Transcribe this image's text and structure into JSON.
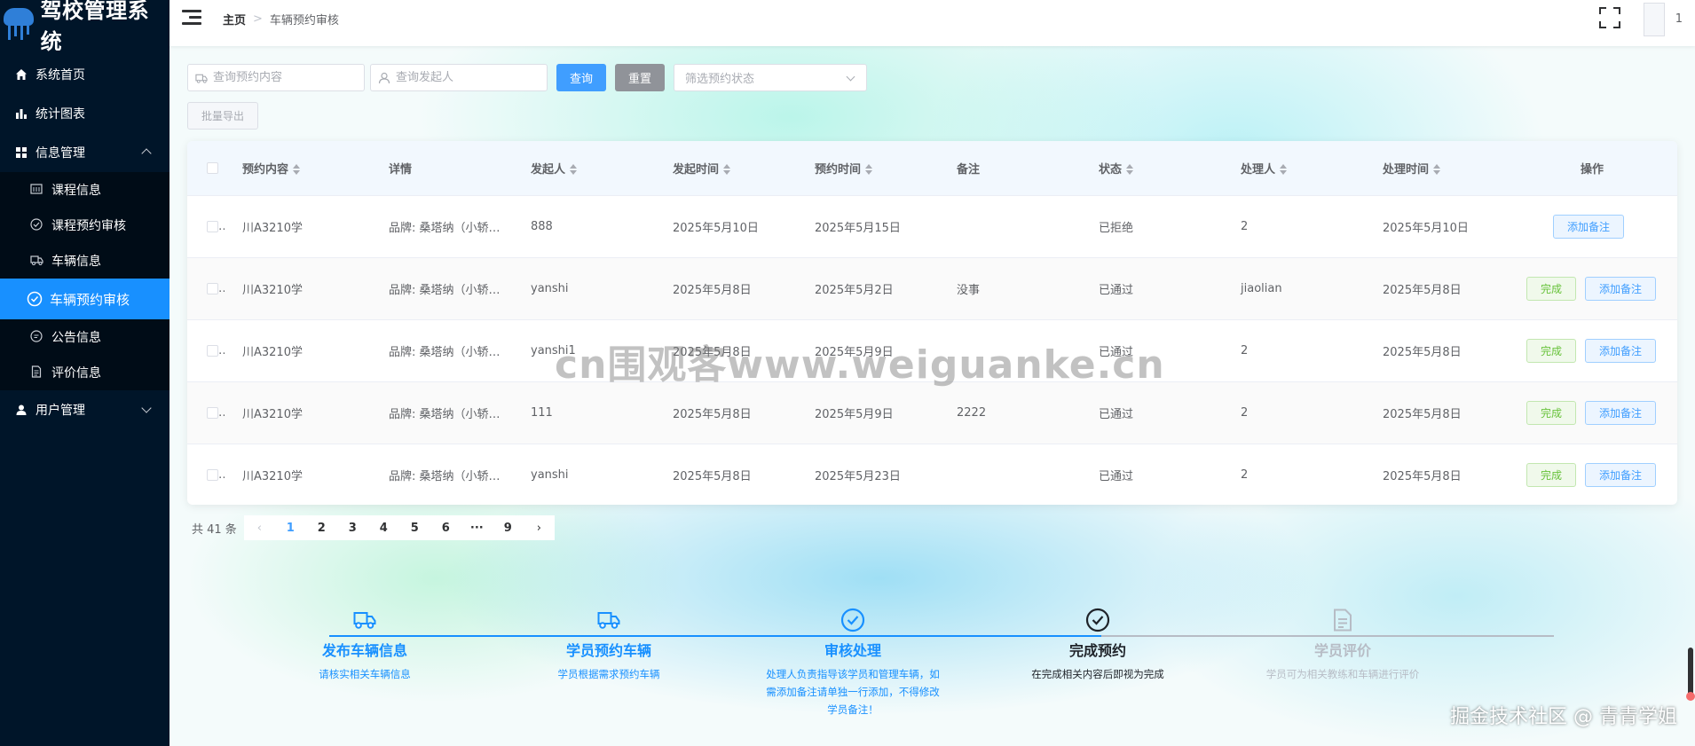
{
  "app": {
    "title": "驾校管理系统"
  },
  "sidebar": {
    "items": [
      {
        "label": "系统首页",
        "icon": "home-icon"
      },
      {
        "label": "统计图表",
        "icon": "bar-chart-icon"
      },
      {
        "label": "信息管理",
        "icon": "grid-icon",
        "expanded": true,
        "children": [
          {
            "label": "课程信息",
            "icon": "calendar-icon"
          },
          {
            "label": "课程预约审核",
            "icon": "check-circle-icon"
          },
          {
            "label": "车辆信息",
            "icon": "truck-icon"
          },
          {
            "label": "车辆预约审核",
            "icon": "check-circle-icon",
            "active": true
          },
          {
            "label": "公告信息",
            "icon": "chat-icon"
          },
          {
            "label": "评价信息",
            "icon": "document-icon"
          }
        ]
      },
      {
        "label": "用户管理",
        "icon": "user-icon",
        "expanded": false
      }
    ]
  },
  "header": {
    "breadcrumb": {
      "home": "主页",
      "separator": ">",
      "current": "车辆预约审核"
    },
    "user_count": "1"
  },
  "filters": {
    "content_placeholder": "查询预约内容",
    "initiator_placeholder": "查询发起人",
    "query_label": "查询",
    "reset_label": "重置",
    "status_placeholder": "筛选预约状态",
    "export_label": "批量导出"
  },
  "table": {
    "columns": {
      "content": "预约内容",
      "details": "详情",
      "initiator": "发起人",
      "start_time": "发起时间",
      "booking_time": "预约时间",
      "remark": "备注",
      "status": "状态",
      "handler": "处理人",
      "handle_time": "处理时间",
      "ops": "操作"
    },
    "done_label": "完成",
    "note_label": "添加备注",
    "rows": [
      {
        "content": "川A3210学",
        "details": "品牌: 桑塔纳（小轿车…",
        "initiator": "888",
        "start_time": "2025年5月10日",
        "booking_time": "2025年5月15日",
        "remark": "",
        "status": "已拒绝",
        "handler": "2",
        "handle_time": "2025年5月10日",
        "show_done": false
      },
      {
        "content": "川A3210学",
        "details": "品牌: 桑塔纳（小轿车…",
        "initiator": "yanshi",
        "start_time": "2025年5月8日",
        "booking_time": "2025年5月2日",
        "remark": "没事",
        "status": "已通过",
        "handler": "jiaolian",
        "handle_time": "2025年5月8日",
        "show_done": true
      },
      {
        "content": "川A3210学",
        "details": "品牌: 桑塔纳（小轿车…",
        "initiator": "yanshi1",
        "start_time": "2025年5月8日",
        "booking_time": "2025年5月9日",
        "remark": "",
        "status": "已通过",
        "handler": "2",
        "handle_time": "2025年5月8日",
        "show_done": true
      },
      {
        "content": "川A3210学",
        "details": "品牌: 桑塔纳（小轿车…",
        "initiator": "111",
        "start_time": "2025年5月8日",
        "booking_time": "2025年5月9日",
        "remark": "2222",
        "status": "已通过",
        "handler": "2",
        "handle_time": "2025年5月8日",
        "show_done": true
      },
      {
        "content": "川A3210学",
        "details": "品牌: 桑塔纳（小轿车…",
        "initiator": "yanshi",
        "start_time": "2025年5月8日",
        "booking_time": "2025年5月23日",
        "remark": "",
        "status": "已通过",
        "handler": "2",
        "handle_time": "2025年5月8日",
        "show_done": true
      }
    ]
  },
  "pagination": {
    "total": "共 41 条",
    "pages": [
      "1",
      "2",
      "3",
      "4",
      "5",
      "6",
      "···",
      "9"
    ],
    "current": "1"
  },
  "steps": [
    {
      "title": "发布车辆信息",
      "desc": "请核实相关车辆信息",
      "icon": "truck-icon",
      "state": "done"
    },
    {
      "title": "学员预约车辆",
      "desc": "学员根据需求预约车辆",
      "icon": "truck-icon",
      "state": "done"
    },
    {
      "title": "审核处理",
      "desc": "处理人负责指导该学员和管理车辆，如需添加备注请单独一行添加，不得修改学员备注！",
      "icon": "check-circle-icon",
      "state": "current"
    },
    {
      "title": "完成预约",
      "desc": "在完成相关内容后即视为完成",
      "icon": "check-circle-icon",
      "state": "next"
    },
    {
      "title": "学员评价",
      "desc": "学员可为相关教练和车辆进行评价",
      "icon": "document-icon",
      "state": "pending"
    }
  ],
  "colors": {
    "sidebar_bg": "#001529",
    "active": "#1890ff",
    "primary": "#409eff",
    "success": "#67c23a"
  },
  "overlay": {
    "watermark": "cn围观客www.weiguanke.cn",
    "credit": "掘金技术社区 @ 青青学姐"
  }
}
